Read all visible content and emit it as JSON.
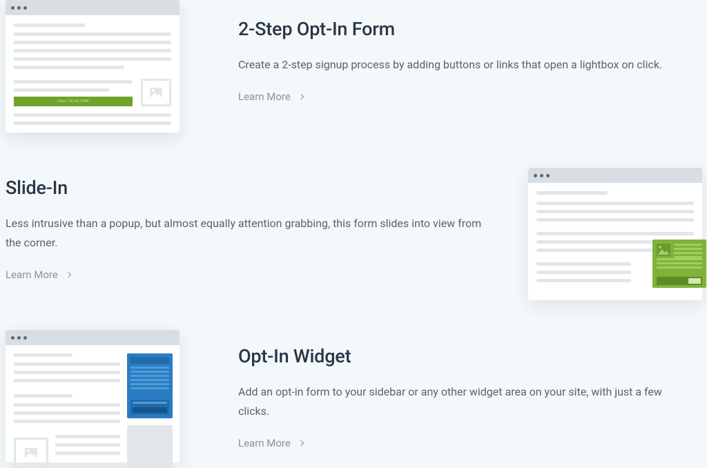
{
  "features": [
    {
      "title": "2-Step Opt-In Form",
      "description": "Create a 2-step signup process by adding buttons or links that open a lightbox on click.",
      "cta": "Learn More",
      "illustration_cta_label": "CALL TO ACTION"
    },
    {
      "title": "Slide-In",
      "description": "Less intrusive than a popup, but almost equally attention grabbing, this form slides into view from the corner.",
      "cta": "Learn More"
    },
    {
      "title": "Opt-In Widget",
      "description": "Add an opt-in form to your sidebar or any other widget area on your site, with just a few clicks.",
      "cta": "Learn More"
    }
  ]
}
